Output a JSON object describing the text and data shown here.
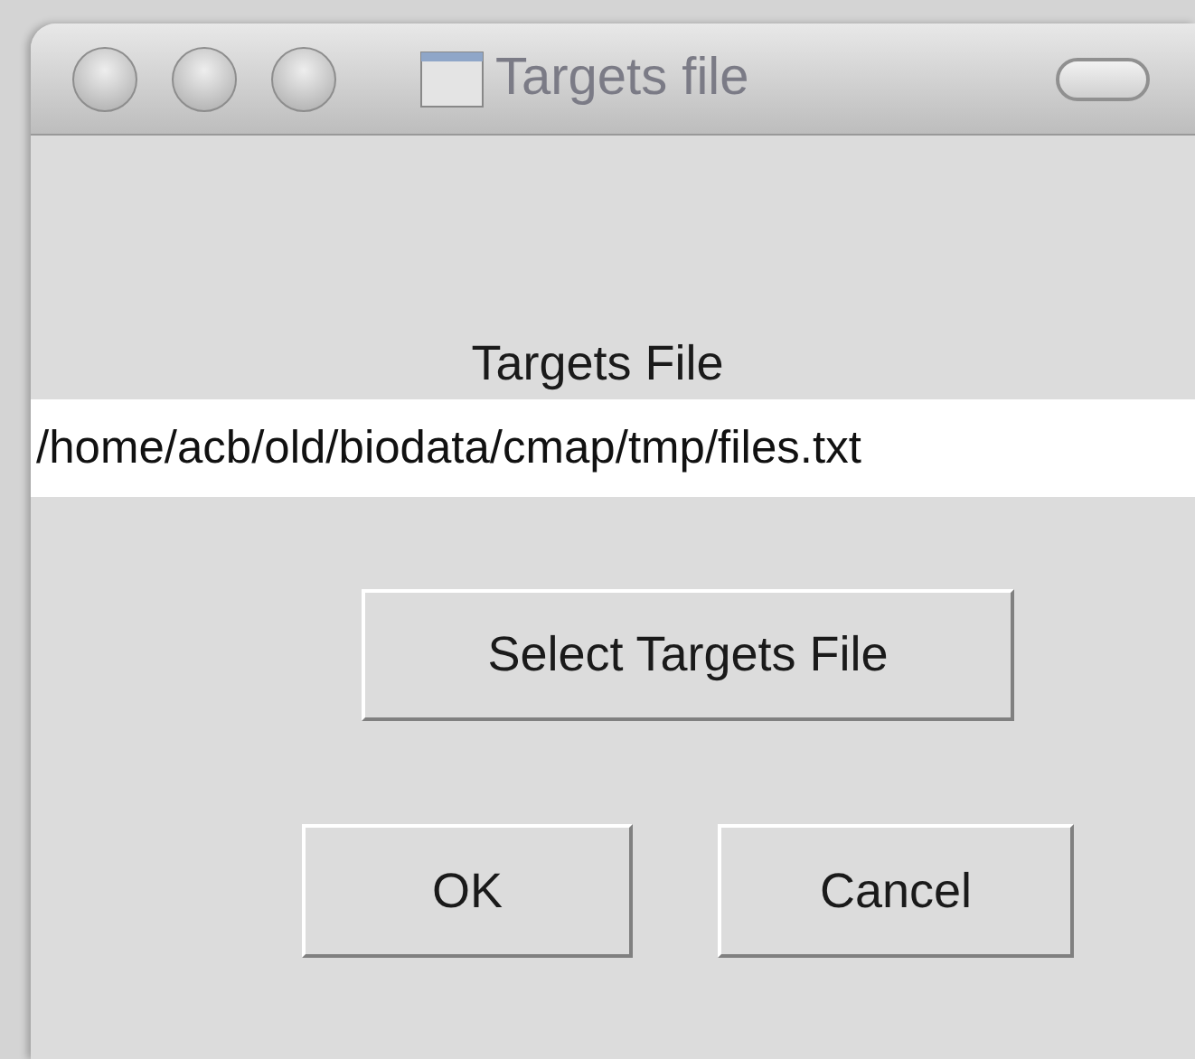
{
  "window": {
    "title": "Targets file"
  },
  "label": "Targets File",
  "path_field": {
    "value": "/home/acb/old/biodata/cmap/tmp/files.txt"
  },
  "select_button": "Select Targets File",
  "buttons": [
    "OK",
    "Cancel"
  ]
}
